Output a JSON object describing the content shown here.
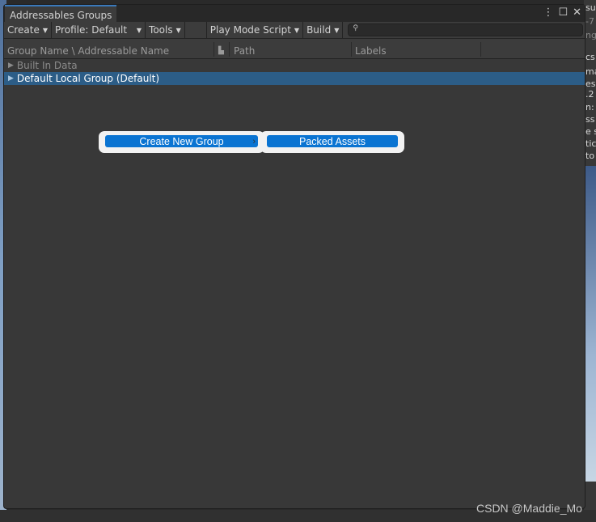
{
  "window": {
    "title": "Addressables Groups",
    "controls": [
      "⋮",
      "☐",
      "✕"
    ]
  },
  "toolbar": {
    "create": "Create",
    "profile": "Profile: Default",
    "tools": "Tools",
    "play_mode": "Play Mode Script",
    "build": "Build",
    "search_placeholder": ""
  },
  "columns": {
    "name": "Group Name \\ Addressable Name",
    "path": "Path",
    "labels": "Labels"
  },
  "rows": [
    {
      "label": "Built In Data",
      "state": "disabled"
    },
    {
      "label": "Default Local Group (Default)",
      "state": "selected"
    }
  ],
  "context_menu": {
    "item": "Create New Group",
    "submenu_item": "Packed Assets"
  },
  "right_panel_fragments": [
    "su",
    "-7",
    "ng",
    "cs",
    "ma",
    "es",
    ".2",
    "n:",
    "ss",
    "e s",
    "tic",
    "to"
  ],
  "watermark": "CSDN @Maddie_Mo",
  "colors": {
    "selection": "#2c5d87",
    "menu_highlight": "#0a74d2",
    "tab_accent": "#3a79bb"
  }
}
